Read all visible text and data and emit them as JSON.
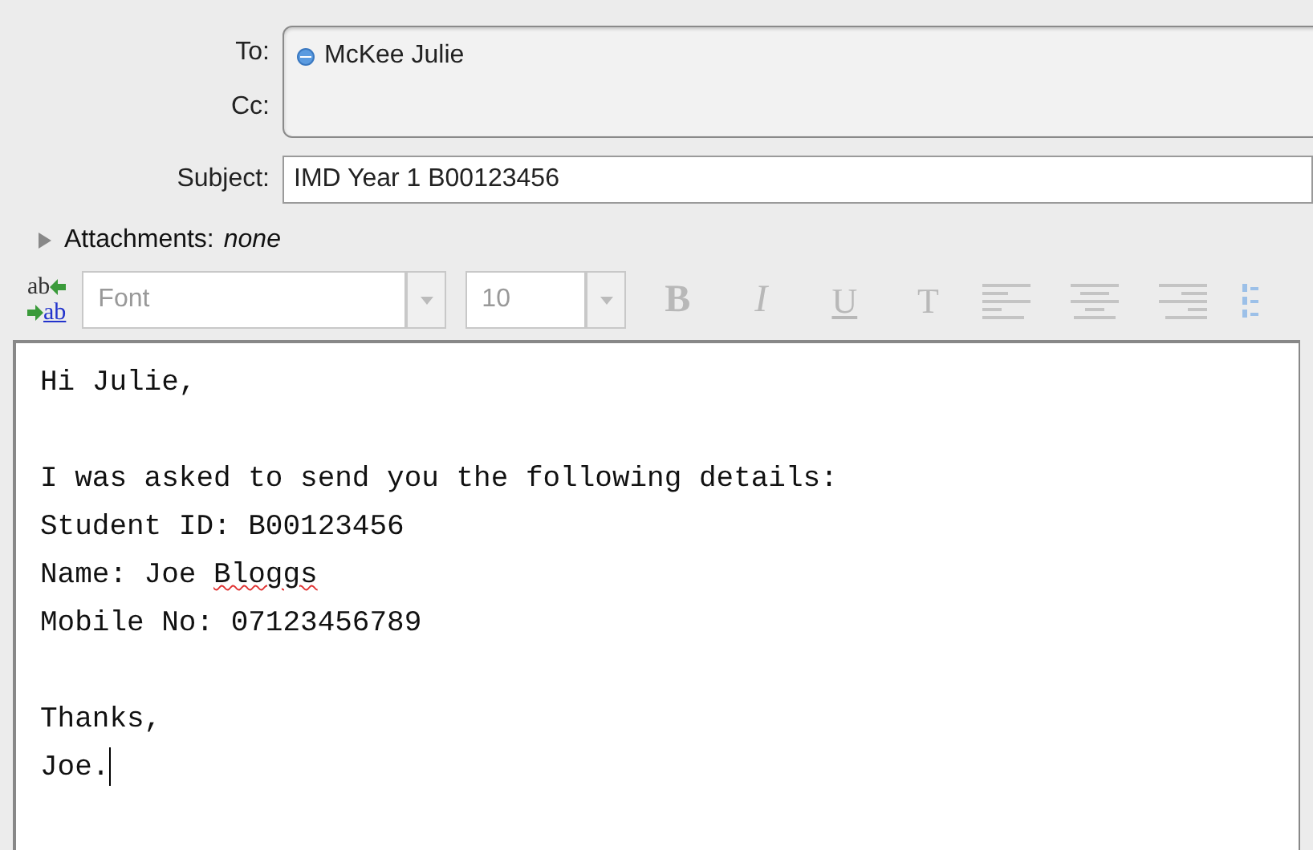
{
  "header": {
    "to_label": "To:",
    "recipients": [
      {
        "name": "McKee Julie"
      }
    ],
    "cc_label": "Cc:",
    "subject_label": "Subject:",
    "subject": "IMD Year 1 B00123456",
    "attachments_label": "Attachments:",
    "attachments_value": "none",
    "attachments_expanded": false
  },
  "toolbar": {
    "spelling_button": {
      "top": "ab",
      "bottom": "ab"
    },
    "font": {
      "placeholder": "Font",
      "disabled": true
    },
    "size": {
      "value": "10",
      "disabled": true
    },
    "format_buttons": [
      {
        "label": "B",
        "kind": "bold",
        "disabled": true
      },
      {
        "label": "I",
        "kind": "italic",
        "disabled": true
      },
      {
        "label": "U",
        "kind": "underline",
        "disabled": true
      },
      {
        "label": "T",
        "kind": "plain",
        "disabled": true
      }
    ],
    "align_buttons": [
      {
        "kind": "left",
        "disabled": true
      },
      {
        "kind": "center",
        "disabled": true
      },
      {
        "kind": "right",
        "disabled": true
      },
      {
        "kind": "numbered",
        "disabled": true
      }
    ]
  },
  "body": {
    "paragraphs": [
      [
        [
          {
            "text": "Hi Julie,"
          }
        ]
      ],
      [
        [
          {
            "text": "I was asked to send you the following details:"
          }
        ],
        [
          {
            "text": "Student ID: B00123456"
          }
        ],
        [
          {
            "text": "Name: Joe "
          },
          {
            "text": "Bloggs",
            "misspelled": true
          }
        ],
        [
          {
            "text": "Mobile No: 07123456789"
          }
        ]
      ],
      [
        [
          {
            "text": "Thanks,"
          }
        ],
        [
          {
            "text": "Joe.",
            "cursor": true
          }
        ]
      ]
    ]
  }
}
